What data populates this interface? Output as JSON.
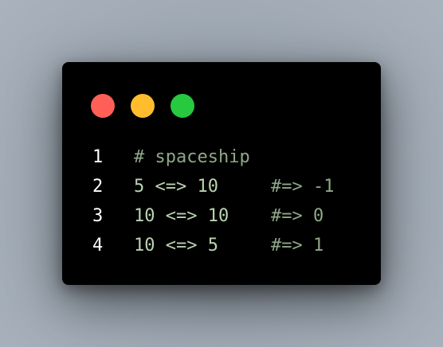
{
  "window_controls": {
    "close_color": "#ff5f56",
    "minimize_color": "#ffbd2e",
    "maximize_color": "#27c93f"
  },
  "colors": {
    "background": "#000000",
    "line_number": "#ffffff",
    "code": "#b9d3b0",
    "comment": "#8fa887"
  },
  "code_lines": [
    {
      "number": "1",
      "code": "# spaceship",
      "comment": ""
    },
    {
      "number": "2",
      "code": "5 <=> 10",
      "comment": "#=> -1"
    },
    {
      "number": "3",
      "code": "10 <=> 10",
      "comment": "#=> 0"
    },
    {
      "number": "4",
      "code": "10 <=> 5",
      "comment": "#=> 1"
    }
  ]
}
